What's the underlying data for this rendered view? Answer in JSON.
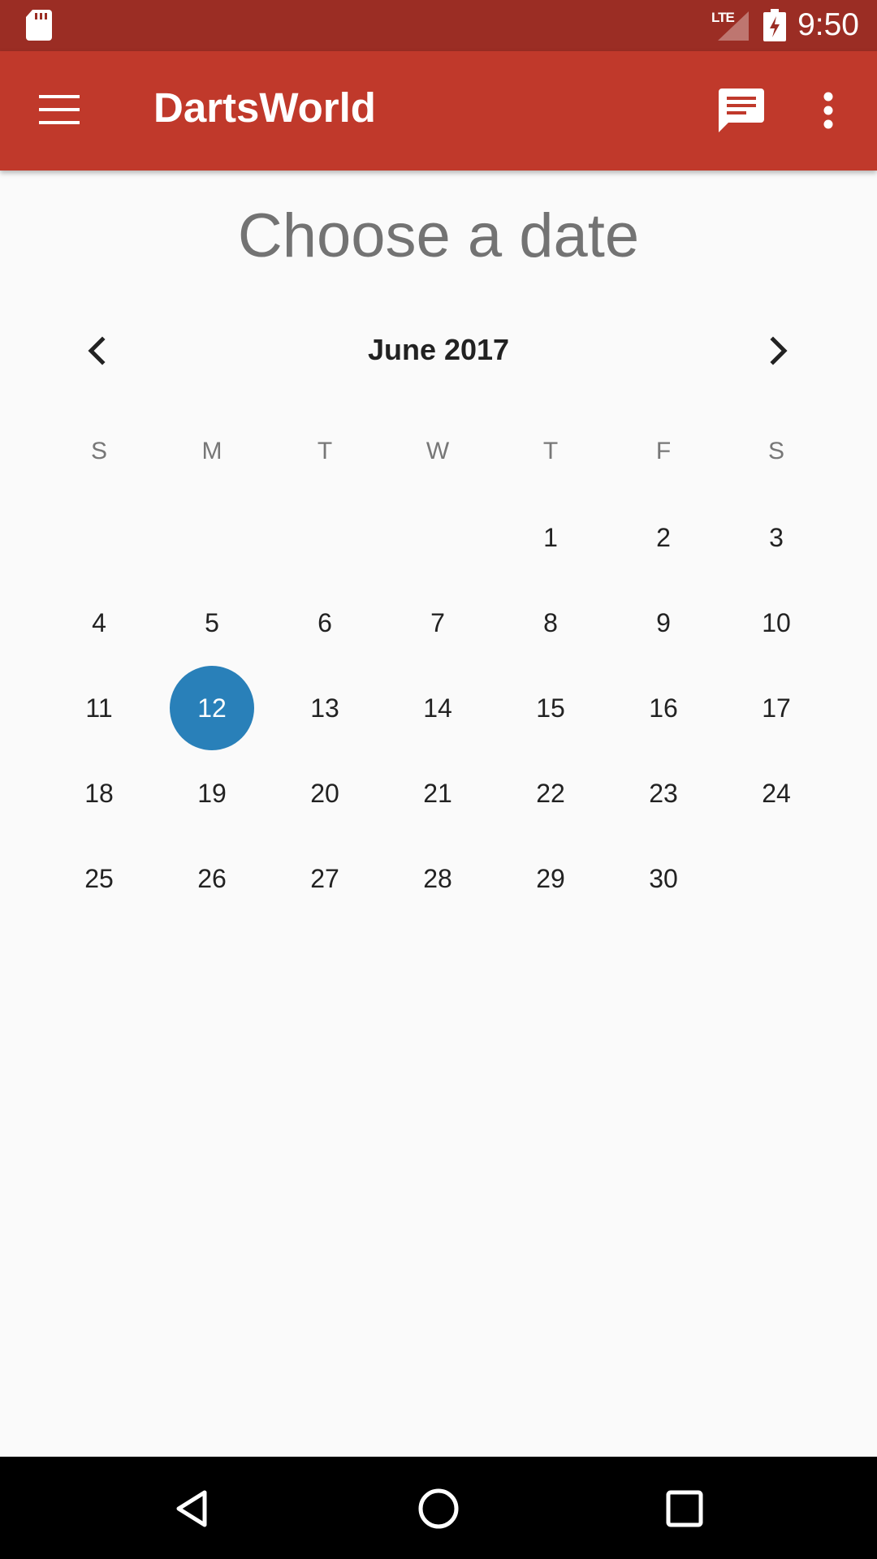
{
  "status_bar": {
    "network_label": "LTE",
    "time": "9:50"
  },
  "app_bar": {
    "title": "DartsWorld",
    "icons": {
      "menu": "hamburger-menu-icon",
      "chat": "chat-message-icon",
      "overflow": "more-vert-icon"
    },
    "color": "#c0392b"
  },
  "page": {
    "title": "Choose a date"
  },
  "calendar": {
    "month_label": "June 2017",
    "weekdays": [
      "S",
      "M",
      "T",
      "W",
      "T",
      "F",
      "S"
    ],
    "first_weekday_index": 4,
    "days": [
      "1",
      "2",
      "3",
      "4",
      "5",
      "6",
      "7",
      "8",
      "9",
      "10",
      "11",
      "12",
      "13",
      "14",
      "15",
      "16",
      "17",
      "18",
      "19",
      "20",
      "21",
      "22",
      "23",
      "24",
      "25",
      "26",
      "27",
      "28",
      "29",
      "30"
    ],
    "selected_day": "12",
    "selected_color": "#2980b9"
  },
  "nav_bar": {
    "icons": [
      "back-icon",
      "home-icon",
      "recents-icon"
    ]
  }
}
